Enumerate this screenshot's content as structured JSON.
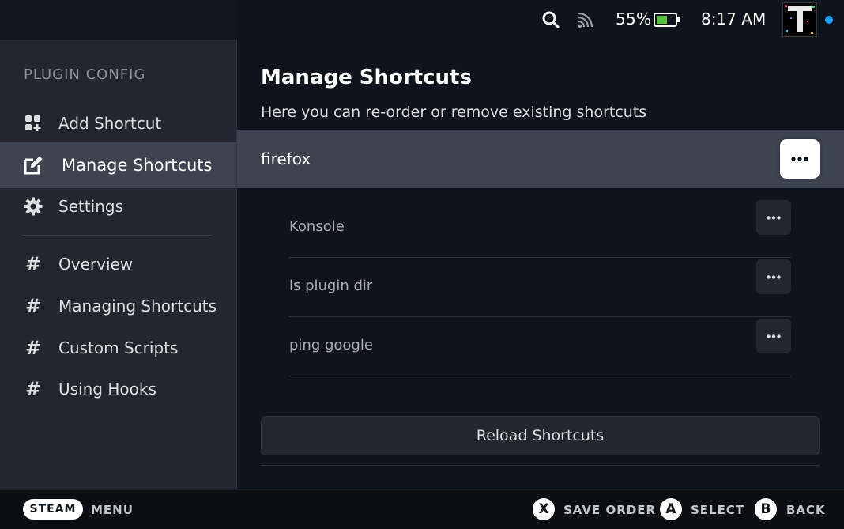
{
  "status_bar": {
    "battery_percent": "55%",
    "time": "8:17 AM",
    "icons": [
      "search-icon",
      "cast-icon",
      "battery-icon",
      "avatar",
      "notification-dot"
    ],
    "accent": "#1a9fff"
  },
  "sidebar": {
    "heading": "PLUGIN CONFIG",
    "items": [
      {
        "label": "Add Shortcut",
        "icon": "grid-plus-icon"
      },
      {
        "label": "Manage Shortcuts",
        "icon": "edit-icon",
        "active": true
      },
      {
        "label": "Settings",
        "icon": "gear-icon"
      },
      {
        "label": "Overview",
        "icon": "hash-icon"
      },
      {
        "label": "Managing Shortcuts",
        "icon": "hash-icon"
      },
      {
        "label": "Custom Scripts",
        "icon": "hash-icon"
      },
      {
        "label": "Using Hooks",
        "icon": "hash-icon"
      }
    ],
    "hash_glyph": "#"
  },
  "main": {
    "title": "Manage Shortcuts",
    "description": "Here you can re-order or remove existing shortcuts",
    "shortcuts": [
      {
        "name": "firefox",
        "selected": true
      },
      {
        "name": "Konsole"
      },
      {
        "name": "ls plugin dir"
      },
      {
        "name": "ping google"
      }
    ],
    "reload_label": "Reload Shortcuts"
  },
  "footer": {
    "steam_label": "STEAM",
    "menu_label": "MENU",
    "x_glyph": "X",
    "save_order_label": "SAVE ORDER",
    "a_glyph": "A",
    "select_label": "SELECT",
    "b_glyph": "B",
    "back_label": "BACK"
  },
  "colors": {
    "background": "#0e141b",
    "sidebar_bg": "#23262e",
    "selected_bg": "#3d4450",
    "text": "#dcdedf"
  }
}
